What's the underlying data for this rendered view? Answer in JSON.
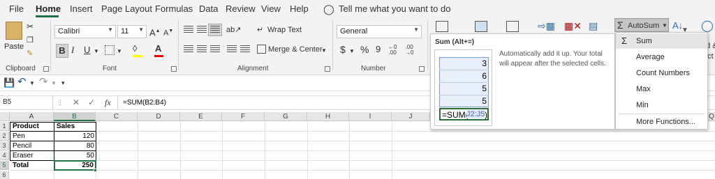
{
  "tabs": [
    "File",
    "Home",
    "Insert",
    "Page Layout",
    "Formulas",
    "Data",
    "Review",
    "View",
    "Help"
  ],
  "tell_me": "Tell me what you want to do",
  "clipboard": {
    "paste": "Paste",
    "label": "Clipboard"
  },
  "font": {
    "name": "Calibri",
    "size": "11",
    "label": "Font"
  },
  "alignment": {
    "wrap": "Wrap Text",
    "merge": "Merge & Center",
    "label": "Alignment"
  },
  "number": {
    "format": "General",
    "label": "Number",
    "currency": "$",
    "percent": "%",
    "comma": "9"
  },
  "autosum_button": "AutoSum",
  "right_cut": {
    "top": "nd &",
    "bottom": "ect"
  },
  "formula_bar": {
    "name_box": "B5",
    "fx": "fx",
    "formula": "=SUM(B2:B4)"
  },
  "columns": [
    "A",
    "B",
    "C",
    "D",
    "E",
    "F",
    "G",
    "H",
    "I",
    "J",
    "Q"
  ],
  "rows": [
    "1",
    "2",
    "3",
    "4",
    "5",
    "6"
  ],
  "cells": {
    "a1": "Product",
    "b1": "Sales",
    "a2": "Pen",
    "b2": "120",
    "a3": "Pencil",
    "b3": "80",
    "a4": "Eraser",
    "b4": "50",
    "a5": "Total",
    "b5": "250"
  },
  "tooltip": {
    "title": "Sum (Alt+=)",
    "description": "Automatically add it up. Your total will appear after the selected cells.",
    "preview_values": [
      "3",
      "6",
      "5",
      "5"
    ],
    "preview_formula_start": "=SUM(",
    "preview_formula_range": "J2:J5",
    "preview_formula_end": ")"
  },
  "autosum_menu": [
    "Sum",
    "Average",
    "Count Numbers",
    "Max",
    "Min",
    "More Functions..."
  ],
  "colors": {
    "excel_green": "#217346",
    "ribbon_bg": "#f3f3f3",
    "selection": "#e5e5e5"
  }
}
